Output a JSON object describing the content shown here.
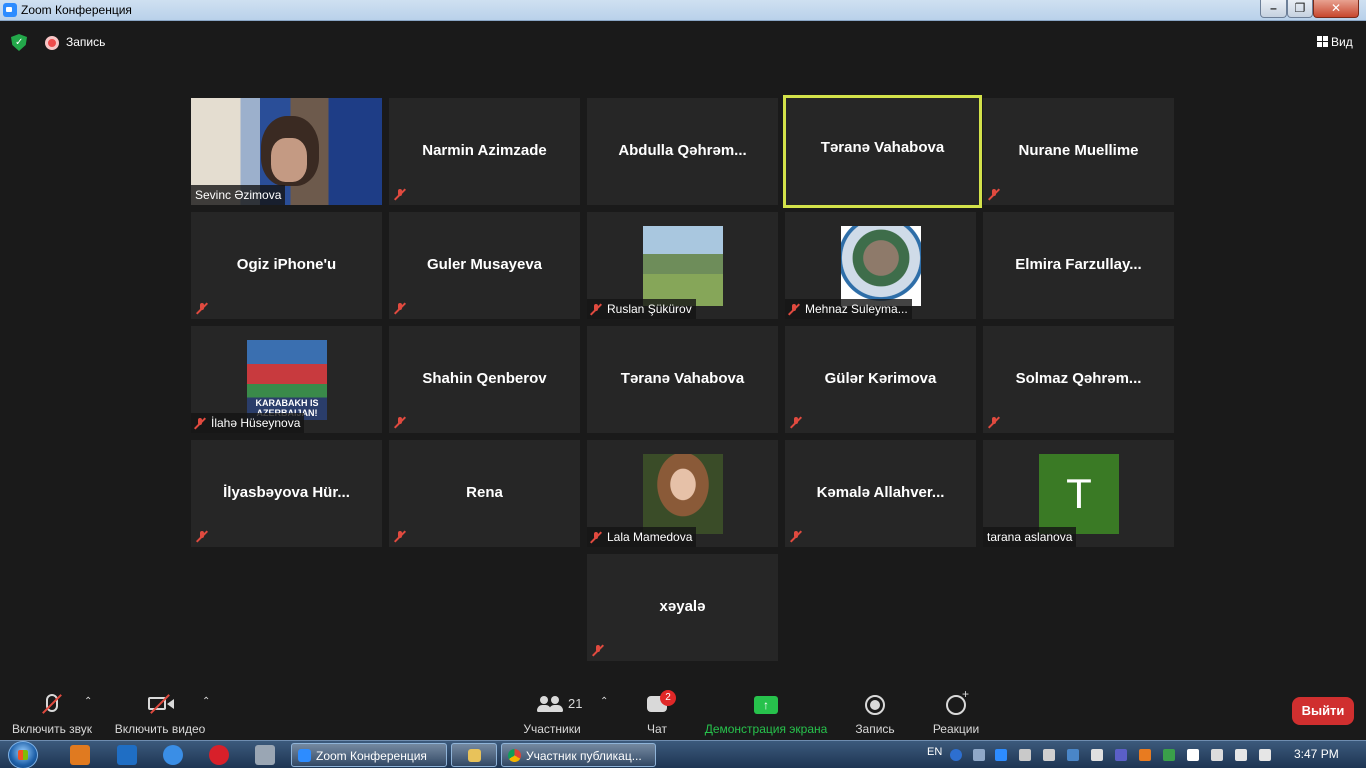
{
  "window": {
    "title": "Zoom Конференция"
  },
  "topbar": {
    "recording_label": "Запись",
    "view_label": "Вид"
  },
  "tiles": [
    {
      "name": "Sevinc Əzimova",
      "kind": "video",
      "muted": false,
      "active": false
    },
    {
      "name": "Narmin Azimzade",
      "kind": "name",
      "muted": true,
      "active": false
    },
    {
      "name": "Abdulla  Qəhrəm...",
      "kind": "name",
      "muted": false,
      "active": false
    },
    {
      "name": "Təranə Vahabova",
      "kind": "name",
      "muted": false,
      "active": true
    },
    {
      "name": "Nurane Muellime",
      "kind": "name",
      "muted": true,
      "active": false
    },
    {
      "name": "Ogiz iPhone'u",
      "kind": "name",
      "muted": true,
      "active": false
    },
    {
      "name": "Guler Musayeva",
      "kind": "name",
      "muted": true,
      "active": false
    },
    {
      "name": "Ruslan Şükürov",
      "kind": "image",
      "image": "field-photo",
      "muted": true,
      "active": false
    },
    {
      "name": "Mehnaz Suleyma...",
      "kind": "image",
      "image": "globe-logo",
      "muted": true,
      "active": false
    },
    {
      "name": "Elmira  Farzullay...",
      "kind": "name",
      "muted": false,
      "active": false
    },
    {
      "name": "İlahə Hüseynova",
      "kind": "image",
      "image": "flag-poster",
      "image_text": "KARABAKH IS AZERBAIJAN!",
      "muted": true,
      "active": false
    },
    {
      "name": "Shahin Qenberov",
      "kind": "name",
      "muted": true,
      "active": false
    },
    {
      "name": "Təranə Vahabova",
      "kind": "name",
      "muted": false,
      "active": false
    },
    {
      "name": "Gülər Kərimova",
      "kind": "name",
      "muted": true,
      "active": false
    },
    {
      "name": "Solmaz  Qəhrəm...",
      "kind": "name",
      "muted": true,
      "active": false
    },
    {
      "name": "İlyasbəyova  Hür...",
      "kind": "name",
      "muted": true,
      "active": false
    },
    {
      "name": "Rena",
      "kind": "name",
      "muted": true,
      "active": false
    },
    {
      "name": "Lala Mamedova",
      "kind": "image",
      "image": "portrait-photo",
      "muted": true,
      "active": false
    },
    {
      "name": "Kəmalə  Allahver...",
      "kind": "name",
      "muted": true,
      "active": false
    },
    {
      "name": "tarana aslanova",
      "kind": "letter",
      "letter": "T",
      "letter_color": "#3a7a25",
      "muted": false,
      "active": false
    },
    {
      "name": "xəyalə",
      "kind": "name",
      "muted": true,
      "active": false
    }
  ],
  "toolbar": {
    "audio_label": "Включить звук",
    "video_label": "Включить видео",
    "participants_label": "Участники",
    "participants_count": "21",
    "chat_label": "Чат",
    "chat_badge": "2",
    "share_label": "Демонстрация экрана",
    "record_label": "Запись",
    "reactions_label": "Реакции",
    "leave_label": "Выйти"
  },
  "taskbar": {
    "tasks": [
      {
        "label": "Zoom Конференция"
      },
      {
        "label": ""
      },
      {
        "label": "Участник публикац..."
      }
    ],
    "lang": "EN",
    "clock": "3:47 PM"
  },
  "colors": {
    "active_border": "#d3e24a",
    "leave": "#d02f2f",
    "share": "#27c24c",
    "muted_icon": "#e04a3f"
  }
}
